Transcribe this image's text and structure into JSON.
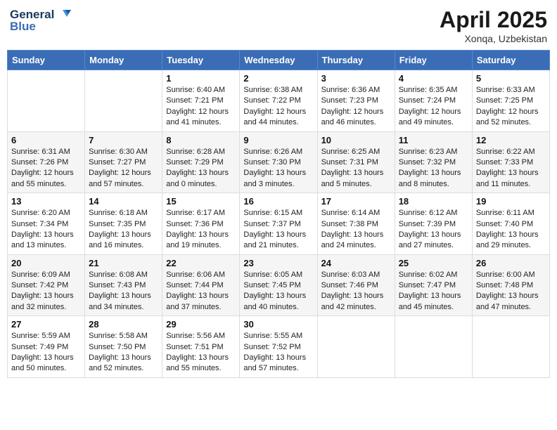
{
  "header": {
    "logo_line1": "General",
    "logo_line2": "Blue",
    "month_title": "April 2025",
    "location": "Xonqa, Uzbekistan"
  },
  "days_of_week": [
    "Sunday",
    "Monday",
    "Tuesday",
    "Wednesday",
    "Thursday",
    "Friday",
    "Saturday"
  ],
  "weeks": [
    [
      {
        "day": "",
        "sunrise": "",
        "sunset": "",
        "daylight": ""
      },
      {
        "day": "",
        "sunrise": "",
        "sunset": "",
        "daylight": ""
      },
      {
        "day": "1",
        "sunrise": "Sunrise: 6:40 AM",
        "sunset": "Sunset: 7:21 PM",
        "daylight": "Daylight: 12 hours and 41 minutes."
      },
      {
        "day": "2",
        "sunrise": "Sunrise: 6:38 AM",
        "sunset": "Sunset: 7:22 PM",
        "daylight": "Daylight: 12 hours and 44 minutes."
      },
      {
        "day": "3",
        "sunrise": "Sunrise: 6:36 AM",
        "sunset": "Sunset: 7:23 PM",
        "daylight": "Daylight: 12 hours and 46 minutes."
      },
      {
        "day": "4",
        "sunrise": "Sunrise: 6:35 AM",
        "sunset": "Sunset: 7:24 PM",
        "daylight": "Daylight: 12 hours and 49 minutes."
      },
      {
        "day": "5",
        "sunrise": "Sunrise: 6:33 AM",
        "sunset": "Sunset: 7:25 PM",
        "daylight": "Daylight: 12 hours and 52 minutes."
      }
    ],
    [
      {
        "day": "6",
        "sunrise": "Sunrise: 6:31 AM",
        "sunset": "Sunset: 7:26 PM",
        "daylight": "Daylight: 12 hours and 55 minutes."
      },
      {
        "day": "7",
        "sunrise": "Sunrise: 6:30 AM",
        "sunset": "Sunset: 7:27 PM",
        "daylight": "Daylight: 12 hours and 57 minutes."
      },
      {
        "day": "8",
        "sunrise": "Sunrise: 6:28 AM",
        "sunset": "Sunset: 7:29 PM",
        "daylight": "Daylight: 13 hours and 0 minutes."
      },
      {
        "day": "9",
        "sunrise": "Sunrise: 6:26 AM",
        "sunset": "Sunset: 7:30 PM",
        "daylight": "Daylight: 13 hours and 3 minutes."
      },
      {
        "day": "10",
        "sunrise": "Sunrise: 6:25 AM",
        "sunset": "Sunset: 7:31 PM",
        "daylight": "Daylight: 13 hours and 5 minutes."
      },
      {
        "day": "11",
        "sunrise": "Sunrise: 6:23 AM",
        "sunset": "Sunset: 7:32 PM",
        "daylight": "Daylight: 13 hours and 8 minutes."
      },
      {
        "day": "12",
        "sunrise": "Sunrise: 6:22 AM",
        "sunset": "Sunset: 7:33 PM",
        "daylight": "Daylight: 13 hours and 11 minutes."
      }
    ],
    [
      {
        "day": "13",
        "sunrise": "Sunrise: 6:20 AM",
        "sunset": "Sunset: 7:34 PM",
        "daylight": "Daylight: 13 hours and 13 minutes."
      },
      {
        "day": "14",
        "sunrise": "Sunrise: 6:18 AM",
        "sunset": "Sunset: 7:35 PM",
        "daylight": "Daylight: 13 hours and 16 minutes."
      },
      {
        "day": "15",
        "sunrise": "Sunrise: 6:17 AM",
        "sunset": "Sunset: 7:36 PM",
        "daylight": "Daylight: 13 hours and 19 minutes."
      },
      {
        "day": "16",
        "sunrise": "Sunrise: 6:15 AM",
        "sunset": "Sunset: 7:37 PM",
        "daylight": "Daylight: 13 hours and 21 minutes."
      },
      {
        "day": "17",
        "sunrise": "Sunrise: 6:14 AM",
        "sunset": "Sunset: 7:38 PM",
        "daylight": "Daylight: 13 hours and 24 minutes."
      },
      {
        "day": "18",
        "sunrise": "Sunrise: 6:12 AM",
        "sunset": "Sunset: 7:39 PM",
        "daylight": "Daylight: 13 hours and 27 minutes."
      },
      {
        "day": "19",
        "sunrise": "Sunrise: 6:11 AM",
        "sunset": "Sunset: 7:40 PM",
        "daylight": "Daylight: 13 hours and 29 minutes."
      }
    ],
    [
      {
        "day": "20",
        "sunrise": "Sunrise: 6:09 AM",
        "sunset": "Sunset: 7:42 PM",
        "daylight": "Daylight: 13 hours and 32 minutes."
      },
      {
        "day": "21",
        "sunrise": "Sunrise: 6:08 AM",
        "sunset": "Sunset: 7:43 PM",
        "daylight": "Daylight: 13 hours and 34 minutes."
      },
      {
        "day": "22",
        "sunrise": "Sunrise: 6:06 AM",
        "sunset": "Sunset: 7:44 PM",
        "daylight": "Daylight: 13 hours and 37 minutes."
      },
      {
        "day": "23",
        "sunrise": "Sunrise: 6:05 AM",
        "sunset": "Sunset: 7:45 PM",
        "daylight": "Daylight: 13 hours and 40 minutes."
      },
      {
        "day": "24",
        "sunrise": "Sunrise: 6:03 AM",
        "sunset": "Sunset: 7:46 PM",
        "daylight": "Daylight: 13 hours and 42 minutes."
      },
      {
        "day": "25",
        "sunrise": "Sunrise: 6:02 AM",
        "sunset": "Sunset: 7:47 PM",
        "daylight": "Daylight: 13 hours and 45 minutes."
      },
      {
        "day": "26",
        "sunrise": "Sunrise: 6:00 AM",
        "sunset": "Sunset: 7:48 PM",
        "daylight": "Daylight: 13 hours and 47 minutes."
      }
    ],
    [
      {
        "day": "27",
        "sunrise": "Sunrise: 5:59 AM",
        "sunset": "Sunset: 7:49 PM",
        "daylight": "Daylight: 13 hours and 50 minutes."
      },
      {
        "day": "28",
        "sunrise": "Sunrise: 5:58 AM",
        "sunset": "Sunset: 7:50 PM",
        "daylight": "Daylight: 13 hours and 52 minutes."
      },
      {
        "day": "29",
        "sunrise": "Sunrise: 5:56 AM",
        "sunset": "Sunset: 7:51 PM",
        "daylight": "Daylight: 13 hours and 55 minutes."
      },
      {
        "day": "30",
        "sunrise": "Sunrise: 5:55 AM",
        "sunset": "Sunset: 7:52 PM",
        "daylight": "Daylight: 13 hours and 57 minutes."
      },
      {
        "day": "",
        "sunrise": "",
        "sunset": "",
        "daylight": ""
      },
      {
        "day": "",
        "sunrise": "",
        "sunset": "",
        "daylight": ""
      },
      {
        "day": "",
        "sunrise": "",
        "sunset": "",
        "daylight": ""
      }
    ]
  ]
}
